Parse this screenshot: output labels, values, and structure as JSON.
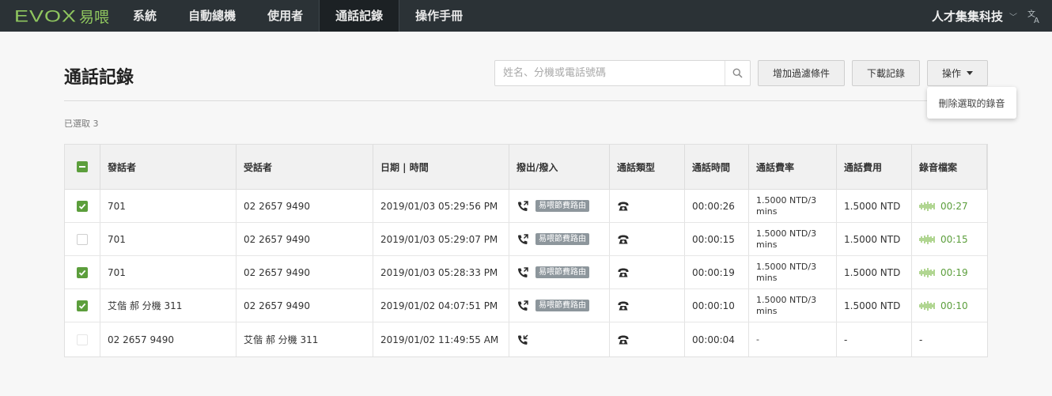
{
  "brand": {
    "latin": "EVOX",
    "cjk": "易喂",
    "color": "#8fc65f"
  },
  "nav": [
    {
      "label": "系統",
      "active": false
    },
    {
      "label": "自動總機",
      "active": false
    },
    {
      "label": "使用者",
      "active": false
    },
    {
      "label": "通話記錄",
      "active": true
    },
    {
      "label": "操作手冊",
      "active": false
    }
  ],
  "account": {
    "name": "人才集集科技",
    "chevron": "﹀"
  },
  "page": {
    "title": "通話記錄",
    "selected_text": "已選取 3"
  },
  "search": {
    "placeholder": "姓名、分機或電話號碼",
    "value": ""
  },
  "buttons": {
    "add_filter": "增加過濾條件",
    "download": "下載記錄",
    "actions": "操作"
  },
  "dropdown": {
    "delete_selected": "刪除選取的錄音"
  },
  "table": {
    "headers": [
      "發話者",
      "受話者",
      "日期 | 時間",
      "撥出/撥入",
      "通話類型",
      "通話時間",
      "通話費率",
      "通話費用",
      "錄音檔案"
    ],
    "rows": [
      {
        "checked": true,
        "disabled": false,
        "caller": "701",
        "callee": "02 2657 9490",
        "datetime": "2019/01/03 05:29:56 PM",
        "direction": "outgoing",
        "route_tag": "易喂節費路由",
        "duration": "00:00:26",
        "rate": "1.5000 NTD/3 mins",
        "cost": "1.5000 NTD",
        "recording": "00:27"
      },
      {
        "checked": false,
        "disabled": false,
        "caller": "701",
        "callee": "02 2657 9490",
        "datetime": "2019/01/03 05:29:07 PM",
        "direction": "outgoing",
        "route_tag": "易喂節費路由",
        "duration": "00:00:15",
        "rate": "1.5000 NTD/3 mins",
        "cost": "1.5000 NTD",
        "recording": "00:15"
      },
      {
        "checked": true,
        "disabled": false,
        "caller": "701",
        "callee": "02 2657 9490",
        "datetime": "2019/01/03 05:28:33 PM",
        "direction": "outgoing",
        "route_tag": "易喂節費路由",
        "duration": "00:00:19",
        "rate": "1.5000 NTD/3 mins",
        "cost": "1.5000 NTD",
        "recording": "00:19"
      },
      {
        "checked": true,
        "disabled": false,
        "caller": "艾偕 郝 分機 311",
        "callee": "02 2657 9490",
        "datetime": "2019/01/02 04:07:51 PM",
        "direction": "outgoing",
        "route_tag": "易喂節費路由",
        "duration": "00:00:10",
        "rate": "1.5000 NTD/3 mins",
        "cost": "1.5000 NTD",
        "recording": "00:10"
      },
      {
        "checked": false,
        "disabled": true,
        "caller": "02 2657 9490",
        "callee": "艾偕 郝 分機 311",
        "datetime": "2019/01/02 11:49:55 AM",
        "direction": "incoming",
        "route_tag": "",
        "duration": "00:00:04",
        "rate": "-",
        "cost": "-",
        "recording": "-"
      }
    ]
  },
  "colors": {
    "accent_green": "#5c9e3c",
    "topbar": "#2b3236",
    "tag_gray": "#8d969c"
  }
}
